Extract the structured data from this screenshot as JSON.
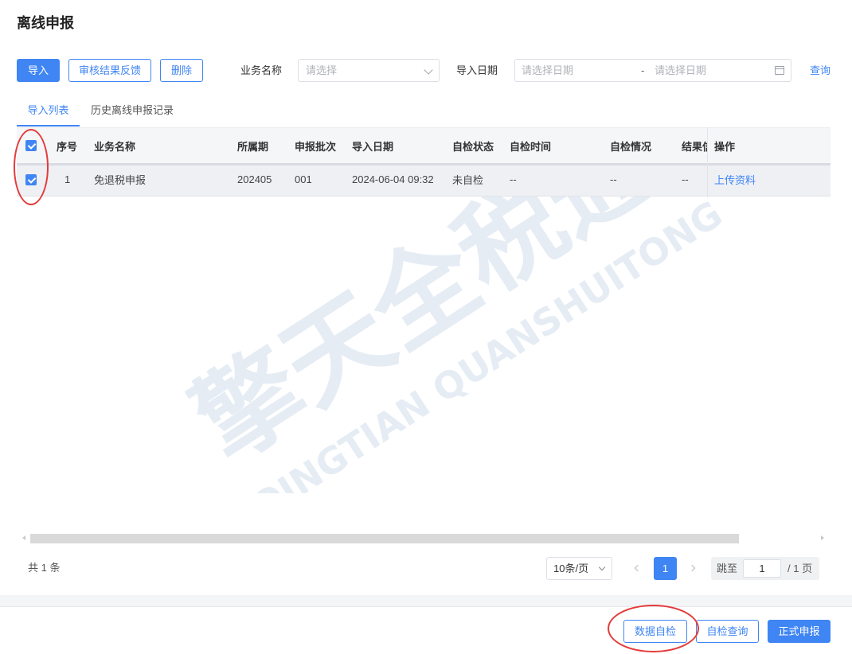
{
  "page": {
    "title": "离线申报"
  },
  "toolbar": {
    "import_label": "导入",
    "feedback_label": "审核结果反馈",
    "delete_label": "删除",
    "business_name_label": "业务名称",
    "business_name_placeholder": "请选择",
    "import_date_label": "导入日期",
    "date_start_placeholder": "请选择日期",
    "date_separator": "-",
    "date_end_placeholder": "请选择日期",
    "query_label": "查询"
  },
  "tabs": [
    {
      "label": "导入列表",
      "active": true
    },
    {
      "label": "历史离线申报记录",
      "active": false
    }
  ],
  "table": {
    "headers": [
      "序号",
      "业务名称",
      "所属期",
      "申报批次",
      "导入日期",
      "自检状态",
      "自检时间",
      "自检情况",
      "结果信",
      "操作"
    ],
    "rows": [
      {
        "checked": true,
        "index": "1",
        "business_name": "免退税申报",
        "period": "202405",
        "batch": "001",
        "import_date": "2024-06-04 09:32",
        "check_status": "未自检",
        "check_time": "--",
        "check_result": "--",
        "result_info": "--",
        "action": "上传资料"
      }
    ],
    "header_checked": true
  },
  "watermark": {
    "cn_text": "擎天全税通",
    "en_text": "QINGTIAN QUANSHUITONG"
  },
  "pagination": {
    "total_text": "共 1 条",
    "page_size": "10条/页",
    "current_page": "1",
    "jump_label": "跳至",
    "jump_value": "1",
    "total_pages_text": "/ 1 页"
  },
  "footer": {
    "data_check_label": "数据自检",
    "check_query_label": "自检查询",
    "formal_submit_label": "正式申报"
  },
  "colors": {
    "accent": "#3f85f4",
    "annotation": "#e43b3b"
  }
}
